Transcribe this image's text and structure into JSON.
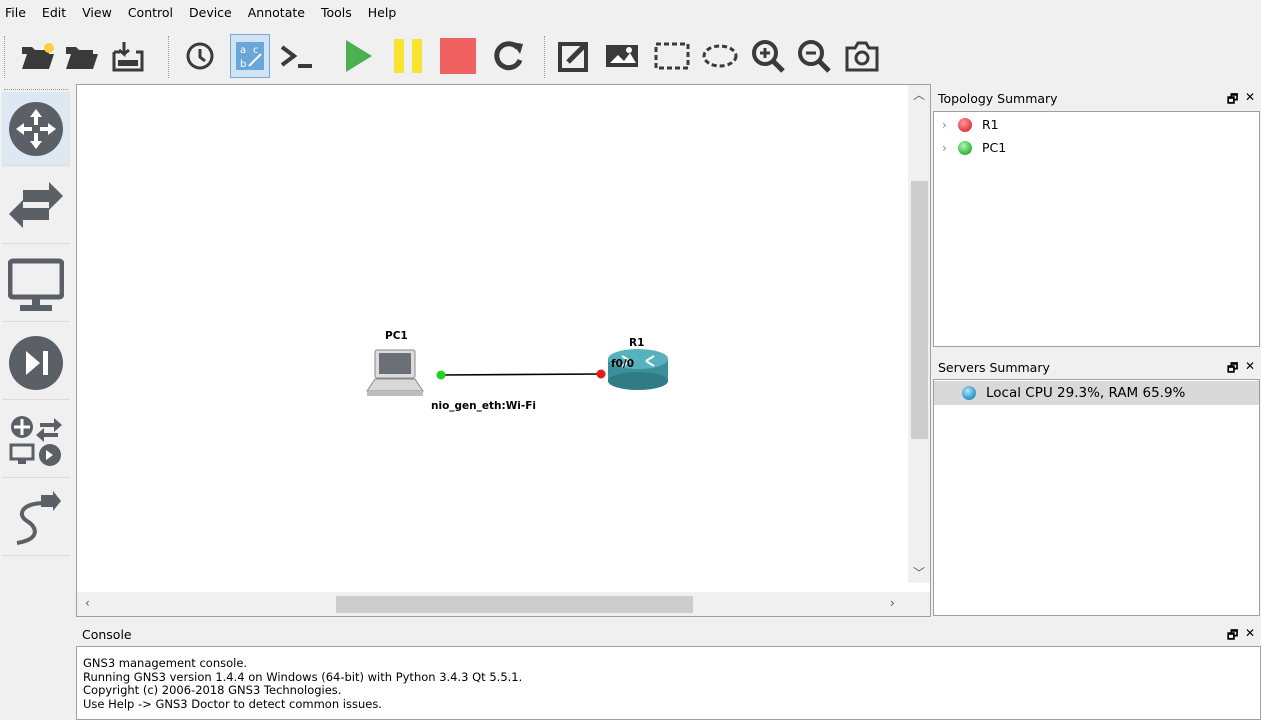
{
  "menu": [
    "File",
    "Edit",
    "View",
    "Control",
    "Device",
    "Annotate",
    "Tools",
    "Help"
  ],
  "toolbar_icons": [
    "new-project-icon",
    "open-project-icon",
    "save-snapshot-icon",
    "snapshot-clock-icon",
    "show-interface-labels-icon",
    "console-all-icon",
    "start-all-icon",
    "suspend-all-icon",
    "stop-all-icon",
    "reload-all-icon",
    "add-note-icon",
    "insert-image-icon",
    "draw-rectangle-icon",
    "draw-ellipse-icon",
    "zoom-in-icon",
    "zoom-out-icon",
    "screenshot-icon"
  ],
  "device_panel": [
    "routers-icon",
    "switches-icon",
    "end-devices-icon",
    "security-devices-icon",
    "all-devices-icon",
    "add-link-icon"
  ],
  "canvas": {
    "nodes": {
      "pc": {
        "label": "PC1"
      },
      "router": {
        "label": "R1"
      }
    },
    "links": {
      "pc_port_label": "nio_gen_eth:Wi-Fi",
      "router_port_label": "f0/0"
    }
  },
  "topology_summary": {
    "title": "Topology Summary",
    "items": [
      {
        "name": "R1",
        "status_color": "#e8434b"
      },
      {
        "name": "PC1",
        "status_color": "#3cc24a"
      }
    ]
  },
  "servers_summary": {
    "title": "Servers Summary",
    "items": [
      {
        "text": "Local CPU 29.3%, RAM 65.9%"
      }
    ]
  },
  "console": {
    "title": "Console",
    "lines": [
      "GNS3 management console.",
      "Running GNS3 version 1.4.4 on Windows (64-bit) with Python 3.4.3 Qt 5.5.1.",
      "Copyright (c) 2006-2018 GNS3 Technologies.",
      "Use Help -> GNS3 Doctor to detect common issues."
    ]
  },
  "dock_controls": {
    "float": "🗗",
    "close": "✕"
  },
  "colors": {
    "start": "#4caf50",
    "suspend": "#f6e531",
    "stop": "#f06262",
    "router": "#3a8f9a"
  }
}
